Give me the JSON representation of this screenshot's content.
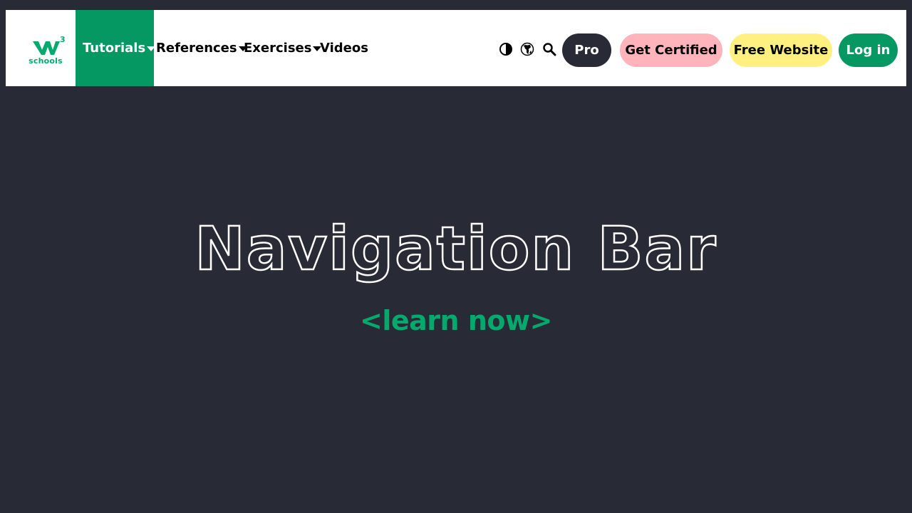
{
  "logo": {
    "text": "schools",
    "superscript": "3",
    "brand_color": "#04AA6D"
  },
  "nav": {
    "tutorials": "Tutorials",
    "references": "References",
    "exercises": "Exercises",
    "videos": "Videos"
  },
  "icons": {
    "contrast": "contrast-icon",
    "globe": "globe-icon",
    "search": "search-icon"
  },
  "buttons": {
    "pro": "Pro",
    "get_certified": "Get Certified",
    "free_website": "Free Website",
    "login": "Log in"
  },
  "hero": {
    "title": "Navigation Bar",
    "link": "<learn now>"
  },
  "colors": {
    "page_bg": "#282A35",
    "accent_green": "#04AA6D",
    "active_tab": "#059862",
    "pink": "#FFB3BB",
    "yellow": "#FFF080"
  }
}
